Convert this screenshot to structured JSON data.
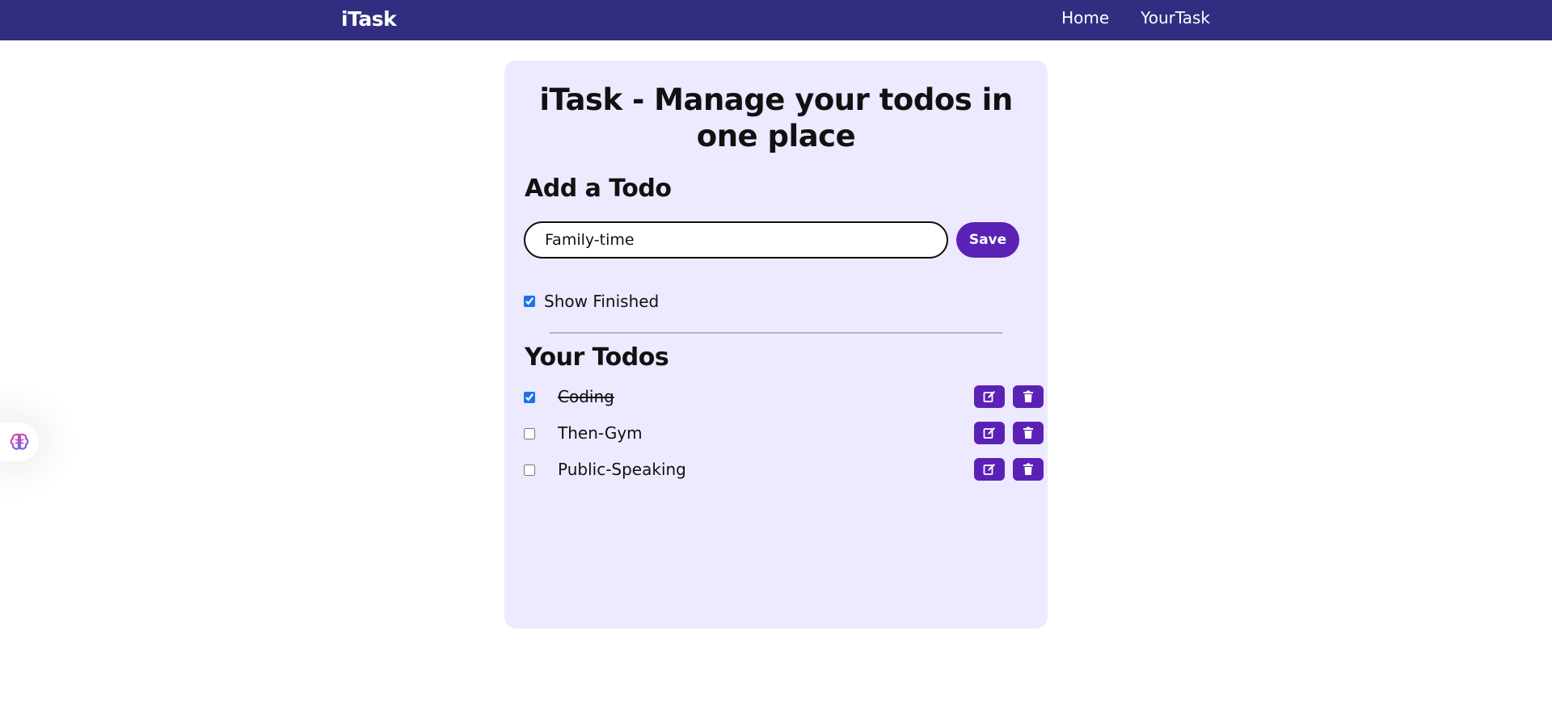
{
  "navbar": {
    "logo": "iTask",
    "links": [
      "Home",
      "YourTask"
    ]
  },
  "main": {
    "title": "iTask - Manage your todos in one place",
    "add_heading": "Add a Todo",
    "input": {
      "value": "Family-time",
      "placeholder": ""
    },
    "save_label": "Save",
    "show_finished": {
      "label": "Show Finished",
      "checked": true
    },
    "todos_heading": "Your Todos",
    "todos": [
      {
        "text": "Coding",
        "done": true
      },
      {
        "text": "Then-Gym",
        "done": false
      },
      {
        "text": "Public-Speaking",
        "done": false
      }
    ]
  },
  "icons": {
    "edit": "edit-icon",
    "delete": "trash-icon",
    "widget": "brain-icon"
  },
  "colors": {
    "navbar": "#312e81",
    "card": "#ede9fe",
    "accent": "#5b21b6"
  }
}
